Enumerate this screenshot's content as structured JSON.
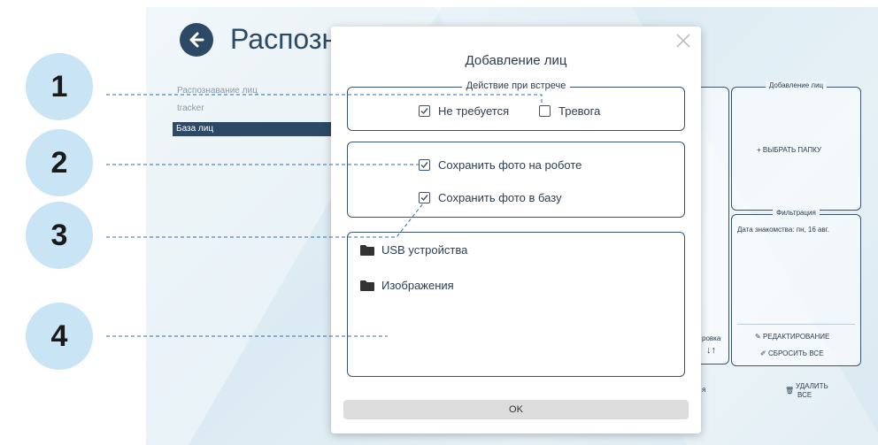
{
  "app": {
    "title": "Распозн",
    "nav": [
      "Распознавание лиц",
      "tracker"
    ],
    "nav_active": "База лиц",
    "right_panels": {
      "add_faces_legend": "Добавление лиц",
      "choose_folder": "+ ВЫБРАТЬ ПАПКУ",
      "filter_legend": "Фильтрация",
      "filter_date": "Дата знакомства: пн, 16 авг.",
      "edit": "РЕДАКТИРОВАНИЕ",
      "reset_all": "СБРОСИТЬ ВСЕ",
      "delete_all_1": "УДАЛИТЬ",
      "delete_all_2": "ВСЕ",
      "sort_partial": "ровка",
      "partial_ya": "я"
    }
  },
  "modal": {
    "title": "Добавление лиц",
    "action_legend": "Действие при встрече",
    "not_required": "Не требуется",
    "alarm": "Тревога",
    "save_robot": "Сохранить фото на роботе",
    "save_db": "Сохранить фото в базу",
    "folders": [
      "USB устройства",
      "Изображения"
    ],
    "ok": "OK"
  },
  "callouts": [
    "1",
    "2",
    "3",
    "4"
  ],
  "colors": {
    "accent": "#2c4a66",
    "callout": "#c9e4f5",
    "border": "#3b5570"
  }
}
